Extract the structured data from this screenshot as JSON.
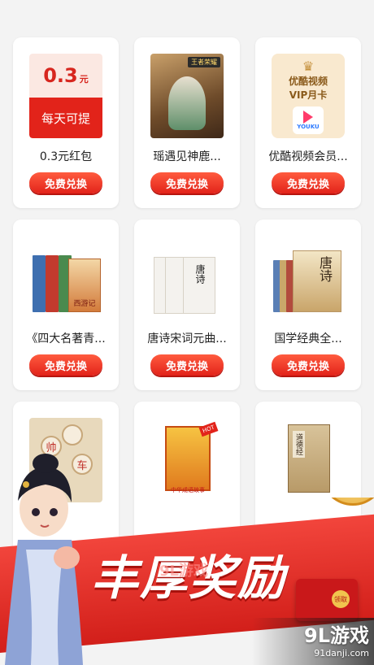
{
  "items": [
    {
      "title": "0.3元红包",
      "button": "免费兑换",
      "thumb": {
        "amount": "0.3",
        "unit": "元",
        "caption": "每天可提"
      }
    },
    {
      "title": "瑶遇见神鹿...",
      "button": "免费兑换",
      "thumb": {
        "tag": "王者荣耀"
      }
    },
    {
      "title": "优酷视频会员...",
      "button": "免费兑换",
      "thumb": {
        "line1": "优酷视频",
        "line2": "VIP月卡",
        "logo": "YOUKU"
      }
    },
    {
      "title": "《四大名著青...",
      "button": "免费兑换",
      "thumb": {
        "label": "西游记"
      }
    },
    {
      "title": "唐诗宋词元曲...",
      "button": "免费兑换",
      "thumb": {
        "label": "唐诗"
      }
    },
    {
      "title": "国学经典全...",
      "button": "免费兑换",
      "thumb": {
        "label": "唐诗"
      }
    },
    {
      "title": "",
      "button": "",
      "thumb": {
        "piece1": "帅",
        "piece2": "车"
      }
    },
    {
      "title": "",
      "button": "",
      "thumb": {
        "label": "中华成语故事",
        "badge": "HOT"
      }
    },
    {
      "title": "",
      "button": "",
      "thumb": {
        "label": "道德经"
      }
    }
  ],
  "banner": {
    "slogan": "丰厚奖励",
    "watermark": "9L游戏",
    "envelope_seal": "领取"
  },
  "brand": {
    "name": "9L游戏",
    "url": "91danji.com"
  },
  "colors": {
    "accent": "#e2231a",
    "background": "#f3f3f3"
  }
}
